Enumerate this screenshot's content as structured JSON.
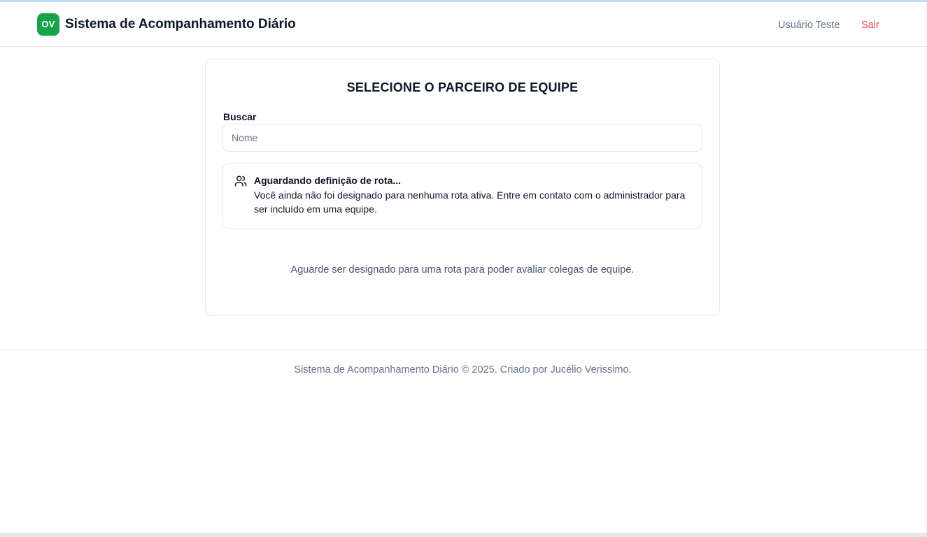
{
  "header": {
    "logo_text": "OV",
    "app_title": "Sistema de Acompanhamento Diário",
    "user_name": "Usuário Teste",
    "logout_label": "Sair"
  },
  "card": {
    "title": "SELECIONE O PARCEIRO DE EQUIPE",
    "search": {
      "label": "Buscar",
      "placeholder": "Nome",
      "value": ""
    },
    "alert": {
      "icon": "users-icon",
      "title": "Aguardando definição de rota...",
      "text": "Você ainda não foi designado para nenhuma rota ativa. Entre em contato com o administrador para ser incluído em uma equipe."
    },
    "info_text": "Aguarde ser designado para uma rota para poder avaliar colegas de equipe."
  },
  "footer": {
    "text": "Sistema de Acompanhamento Diário © 2025. Criado por Jucélio Verissimo."
  },
  "colors": {
    "brand": "#16a34a",
    "logout": "#ef4444",
    "muted": "#64748b",
    "border": "#e5e7eb"
  }
}
